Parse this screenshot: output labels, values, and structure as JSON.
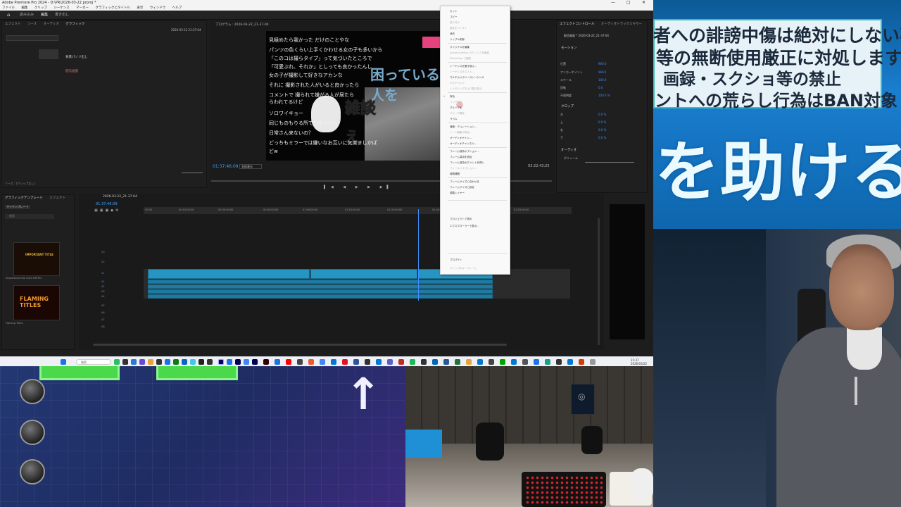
{
  "window": {
    "title": "Adobe Premiere Pro 2024 - D:\\PR\\2026-03-22.prproj *",
    "controls": [
      "—",
      "□",
      "✕"
    ]
  },
  "menubar": [
    "ファイル",
    "編集",
    "クリップ",
    "シーケンス",
    "マーカー",
    "グラフィックとタイトル",
    "表示",
    "ウィンドウ",
    "ヘルプ"
  ],
  "workspace_tabs": [
    "読み込み",
    "編集",
    "書き出し"
  ],
  "project_panel": {
    "tabs": [
      "エフェクト",
      "ソース",
      "オーディオ",
      "グラフィック"
    ],
    "timestamp": "2026-03-22 21:37:04",
    "items": [
      "背景パノリ出し",
      "配信画面"
    ],
    "footer": "ソース : (クリップなし)"
  },
  "program_monitor": {
    "title": "プログラム : 2026-03-22_21-37-04",
    "timecode": "01:37:46:09",
    "fit": "全体表示",
    "duration": "03:22:43:25",
    "video_lines": [
      "見極めたら我かった だけのことやな",
      "パンツの色くらい上手くかわせる女の子も多いから",
      "「このコは撮らタイプ」って気づいたところで",
      "「可愛ぶれ、それか」としっても良かったんし",
      "女の子が撮影して好きなアカンな",
      "それに 撮影された人がいると良かったら",
      "コメントで 撮られて嫌がる人が居たら",
      "らわれてるけど",
      "ソロワイキョー",
      "同じものもりる所でも来るかな",
      "日常さん来ないの？",
      "どっちもミラーでは嫌いなお互いに気楽ましかば",
      "どw"
    ],
    "overlay_words": [
      "困っている人を",
      "雑談",
      "え"
    ]
  },
  "effect_controls": {
    "tabs": [
      "エフェクトコントロール",
      "オーディオトラックミキサー"
    ],
    "clip": "配信画面 * 2026-03-22_21-37-04",
    "sections": [
      "モーション",
      "クロップ",
      "オーディオ"
    ],
    "rows": [
      {
        "label": "位置",
        "value": "960.0"
      },
      {
        "label": "スケール",
        "value": "100.0"
      },
      {
        "label": "回転",
        "value": "0.0"
      },
      {
        "label": "アンカーポイント",
        "value": "960.0"
      },
      {
        "label": "不透明度",
        "value": "100.0 %"
      },
      {
        "label": "左",
        "value": "0.0 %"
      },
      {
        "label": "上",
        "value": "0.0 %"
      },
      {
        "label": "右",
        "value": "0.0 %"
      },
      {
        "label": "下",
        "value": "0.0 %"
      }
    ],
    "audio_volume": "ボリューム"
  },
  "timeline": {
    "sequence": "2026-03-22_21-37-04",
    "timecode": "01:37:46:09",
    "ruler_ticks": [
      "00:00",
      "00:15:00:00",
      "00:30:00:00",
      "00:45:00:00",
      "01:00:00:00",
      "01:15:00:00",
      "01:30:00:00",
      "01:45:00:00",
      "02:00:00:00",
      "02:15:00:00"
    ],
    "tracks": [
      "V3",
      "V2",
      "V1",
      "A1",
      "A2",
      "A3",
      "A4",
      "A5",
      "A6",
      "A7",
      "A8"
    ]
  },
  "media_bin": {
    "tabs": [
      "グラフィックテンプレート",
      "エフェクト"
    ],
    "subtab": "マイテンプレート",
    "search": "検索",
    "items": [
      {
        "caption": "IMPORTANT TITLE",
        "label": "Importance title 2024 RETRO"
      },
      {
        "caption": "FLAMING TITLES",
        "label": "Flaming Titles"
      }
    ]
  },
  "context_menu": {
    "items": [
      {
        "label": "カット",
        "enabled": true
      },
      {
        "label": "コピー",
        "enabled": true
      },
      {
        "label": "貼り付け",
        "enabled": false
      },
      {
        "label": "属性をペースト",
        "enabled": false
      },
      {
        "label": "消去",
        "enabled": true
      },
      {
        "label": "リップル削除",
        "enabled": true
      },
      {
        "label": "オリジナルを編集",
        "enabled": true
      },
      {
        "label": "Adobe Audition でクリップを編集",
        "enabled": false
      },
      {
        "label": "Photoshop で編集",
        "enabled": false
      },
      {
        "label": "シーケンスを置き換え...",
        "enabled": true
      },
      {
        "label": "シーケンスをネスト...",
        "enabled": false
      },
      {
        "label": "マルチカメラソースシーケンス",
        "enabled": true
      },
      {
        "label": "マルチカメラ",
        "enabled": false
      },
      {
        "label": "レンダリングおよび置き換え...",
        "enabled": false
      },
      {
        "label": "有効",
        "enabled": true
      },
      {
        "label": "リンク解除",
        "enabled": false
      },
      {
        "label": "グループ化",
        "enabled": true
      },
      {
        "label": "グループ解除",
        "enabled": false
      },
      {
        "label": "ラベル",
        "enabled": true
      },
      {
        "label": "速度・デュレーション...",
        "enabled": true
      },
      {
        "label": "シーン編集の検出...",
        "enabled": false
      },
      {
        "label": "オーディオゲイン...",
        "enabled": true
      },
      {
        "label": "オーディオチャンネル...",
        "enabled": true
      },
      {
        "label": "フレーム保持オプション...",
        "enabled": true
      },
      {
        "label": "フレーム保持を追加",
        "enabled": true
      },
      {
        "label": "フレーム保持セグメントを挿入",
        "enabled": true
      },
      {
        "label": "フィールドオプション...",
        "enabled": false
      },
      {
        "label": "時間補間",
        "enabled": true
      },
      {
        "label": "フレームサイズに合わせる",
        "enabled": true
      },
      {
        "label": "フレームサイズに設定",
        "enabled": true
      },
      {
        "label": "調整レイヤー",
        "enabled": true
      },
      {
        "label": "プロジェクトで表示",
        "enabled": true
      },
      {
        "label": "エクスプローラーで表示...",
        "enabled": true
      },
      {
        "label": "プロパティ",
        "enabled": true
      },
      {
        "label": "クリップのキーフレーム",
        "enabled": false
      }
    ]
  },
  "taskbar": {
    "search": "検索",
    "time": "21:37",
    "date": "2026/03/22"
  },
  "banner": {
    "rules": [
      "者への誹謗中傷は絶対にしない事",
      "等の無断使用厳正に対処します",
      "画録・スクショ等の禁止",
      "ントへの荒らし行為はBAN対象"
    ],
    "title": "を助ける"
  },
  "game": {
    "glyph": "↑"
  },
  "colors": {
    "accent": "#2795c2",
    "timecode": "#3e8eff",
    "banner_bg": "#1a7ed0",
    "game_btn": "#4bd94b"
  }
}
